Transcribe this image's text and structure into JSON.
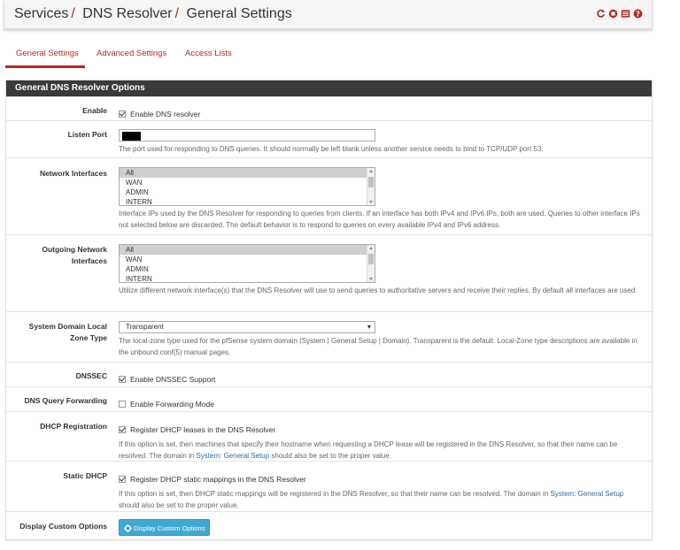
{
  "breadcrumb": [
    "Services",
    "DNS Resolver",
    "General Settings"
  ],
  "breadcrumb_separator": "/",
  "header_icons": [
    "refresh-icon",
    "stop-icon",
    "list-icon",
    "help-icon"
  ],
  "colors": {
    "accent": "#b22b20",
    "panel_header": "#3a3a3a",
    "button": "#41a9d3",
    "link": "#2b6aa3"
  },
  "tabs": [
    {
      "label": "General Settings",
      "active": true
    },
    {
      "label": "Advanced Settings",
      "active": false
    },
    {
      "label": "Access Lists",
      "active": false
    }
  ],
  "panel": {
    "title": "General DNS Resolver Options"
  },
  "enable": {
    "label": "Enable",
    "checkbox_label": "Enable DNS resolver",
    "checked": true
  },
  "listen_port": {
    "label": "Listen Port",
    "value": "",
    "help": "The port used for responding to DNS queries. It should normally be left blank unless another service needs to bind to TCP/UDP port 53."
  },
  "network_interfaces": {
    "label": "Network Interfaces",
    "options": [
      "All",
      "WAN",
      "ADMIN",
      "INTERN"
    ],
    "selected": "All",
    "help": "Interface IPs used by the DNS Resolver for responding to queries from clients. If an interface has both IPv4 and IPv6 IPs, both are used. Queries to other interface IPs not selected below are discarded. The default behavior is to respond to queries on every available IPv4 and IPv6 address."
  },
  "outgoing_interfaces": {
    "label_line1": "Outgoing Network",
    "label_line2": "Interfaces",
    "options": [
      "All",
      "WAN",
      "ADMIN",
      "INTERN"
    ],
    "selected": "All",
    "help": "Utilize different network interface(s) that the DNS Resolver will use to send queries to authoritative servers and receive their replies. By default all interfaces are used."
  },
  "zone_type": {
    "label_line1": "System Domain Local",
    "label_line2": "Zone Type",
    "value": "Transparent",
    "help": "The local-zone type used for the pfSense system domain (System | General Setup | Domain). Transparent is the default. Local-Zone type descriptions are available in the unbound.conf(5) manual pages."
  },
  "dnssec": {
    "label": "DNSSEC",
    "checkbox_label": "Enable DNSSEC Support",
    "checked": true
  },
  "forwarding": {
    "label": "DNS Query Forwarding",
    "checkbox_label": "Enable Forwarding Mode",
    "checked": false
  },
  "dhcp_registration": {
    "label": "DHCP Registration",
    "checkbox_label": "Register DHCP leases in the DNS Resolver",
    "checked": true,
    "help_pre": "If this option is set, then machines that specify their hostname when requesting a DHCP lease will be registered in the DNS Resolver, so that their name can be resolved. The domain in ",
    "help_link": "System: General Setup",
    "help_post": " should also be set to the proper value."
  },
  "static_dhcp": {
    "label": "Static DHCP",
    "checkbox_label": "Register DHCP static mappings in the DNS Resolver",
    "checked": true,
    "help_pre": "If this option is set, then DHCP static mappings will be registered in the DNS Resolver, so that their name can be resolved. The domain in ",
    "help_link": "System: General Setup",
    "help_post": " should also be set to the proper value."
  },
  "custom_options": {
    "label": "Display Custom Options",
    "button_label": "Display Custom Options"
  }
}
